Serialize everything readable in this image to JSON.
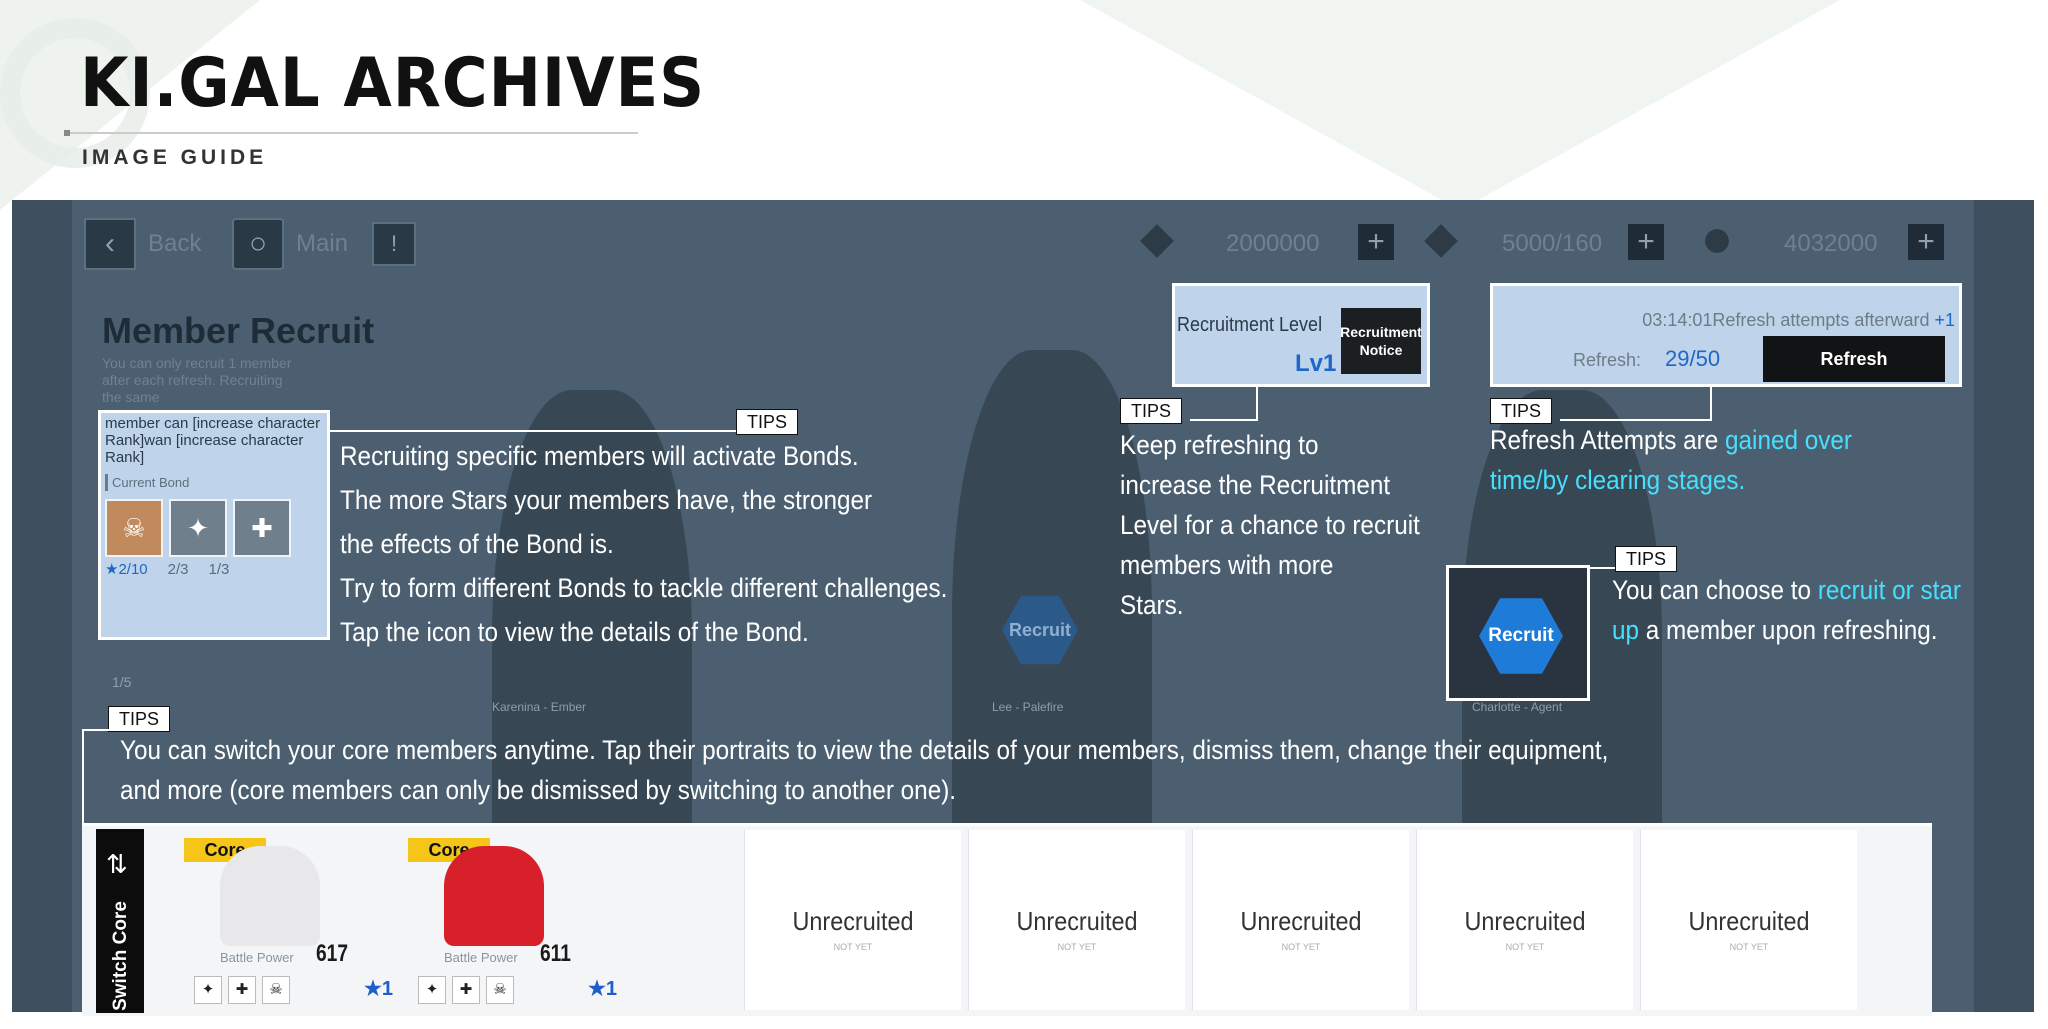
{
  "header": {
    "title": "KI.GAL ARCHIVES",
    "subtitle": "IMAGE GUIDE"
  },
  "game": {
    "back_label": "Back",
    "main_label": "Main",
    "resources": [
      {
        "icon": "ticket-icon",
        "value": "2000000"
      },
      {
        "icon": "stamina-icon",
        "value": "5000/160"
      },
      {
        "icon": "coin-icon",
        "value": "4032000"
      }
    ],
    "page_title": "Member Recruit",
    "page_desc": "You can only recruit 1 member after each refresh. Recruiting the same",
    "bond_panel": {
      "text": "member can [increase character Rank]wan [increase character Rank]",
      "current_bond_label": "Current Bond",
      "counts": [
        "★2/10",
        "2/3",
        "1/3"
      ],
      "extra_count": "1/5"
    },
    "members_bg": [
      "Karenina - Ember",
      "Lee - Palefire",
      "Charlotte - Agent"
    ],
    "recruitment_level": {
      "label": "Recruitment Level",
      "value": "Lv1",
      "notice_button": "Recruitment Notice"
    },
    "refresh": {
      "timer": "03:14:01Refresh attempts afterward",
      "timer_bonus": "+1",
      "label": "Refresh:",
      "count": "29/50",
      "button": "Refresh"
    },
    "recruit_button": "Recruit",
    "recruit_bg_button": "Recruit",
    "bottom": {
      "switch_core_label": "Switch Core",
      "cores": [
        {
          "badge": "Core",
          "bp_label": "Battle Power",
          "bp": "617",
          "stars": "★1",
          "hair": "#e8e8ea"
        },
        {
          "badge": "Core",
          "bp_label": "Battle Power",
          "bp": "611",
          "stars": "★1",
          "hair": "#d8202a"
        }
      ],
      "slots": [
        {
          "label": "Unrecruited",
          "sub": "NOT YET"
        },
        {
          "label": "Unrecruited",
          "sub": "NOT YET"
        },
        {
          "label": "Unrecruited",
          "sub": "NOT YET"
        },
        {
          "label": "Unrecruited",
          "sub": "NOT YET"
        },
        {
          "label": "Unrecruited",
          "sub": "NOT YET"
        }
      ]
    }
  },
  "tips": {
    "tag": "TIPS",
    "bond_lines": [
      "Recruiting specific members will activate Bonds.",
      "The more Stars your members have, the stronger",
      "the effects of the Bond is.",
      "Try to form different Bonds to tackle different challenges.",
      "Tap the icon to view the details of the Bond."
    ],
    "level_lines": [
      "Keep refreshing to",
      "increase the Recruitment",
      "Level for a chance to recruit",
      "members with more",
      "Stars."
    ],
    "refresh_pre": "Refresh Attempts are ",
    "refresh_hl1": "gained over",
    "refresh_hl2": "time/by clearing stages.",
    "recruit_pre": "You can choose to ",
    "recruit_hl1": "recruit or star",
    "recruit_hl2": "up",
    "recruit_post": " a member upon refreshing.",
    "core_line1": "You can switch your core members anytime. Tap their portraits to view the details of your members, dismiss them, change their equipment,",
    "core_line2": "and more (core members can only be dismissed by switching to another one)."
  }
}
